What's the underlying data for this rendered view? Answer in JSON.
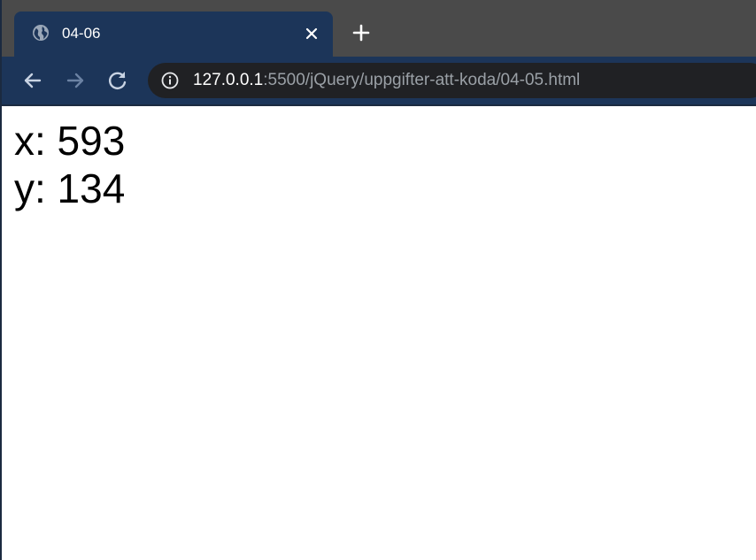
{
  "tab": {
    "title": "04-06",
    "favicon": "globe-icon",
    "close_icon": "close-icon"
  },
  "toolbar": {
    "back_icon": "arrow-left-icon",
    "forward_icon": "arrow-right-icon",
    "reload_icon": "reload-icon",
    "new_tab_icon": "plus-icon",
    "info_icon": "info-icon"
  },
  "address_bar": {
    "host": "127.0.0.1",
    "path": ":5500/jQuery/uppgifter-att-koda/04-05.html"
  },
  "page": {
    "x_line": "x: 593",
    "y_line": "y: 134"
  },
  "colors": {
    "tab_active": "#1c3559",
    "tab_strip": "#4a4a4a",
    "omnibox": "#202124",
    "url_path": "#9aa0a6"
  }
}
